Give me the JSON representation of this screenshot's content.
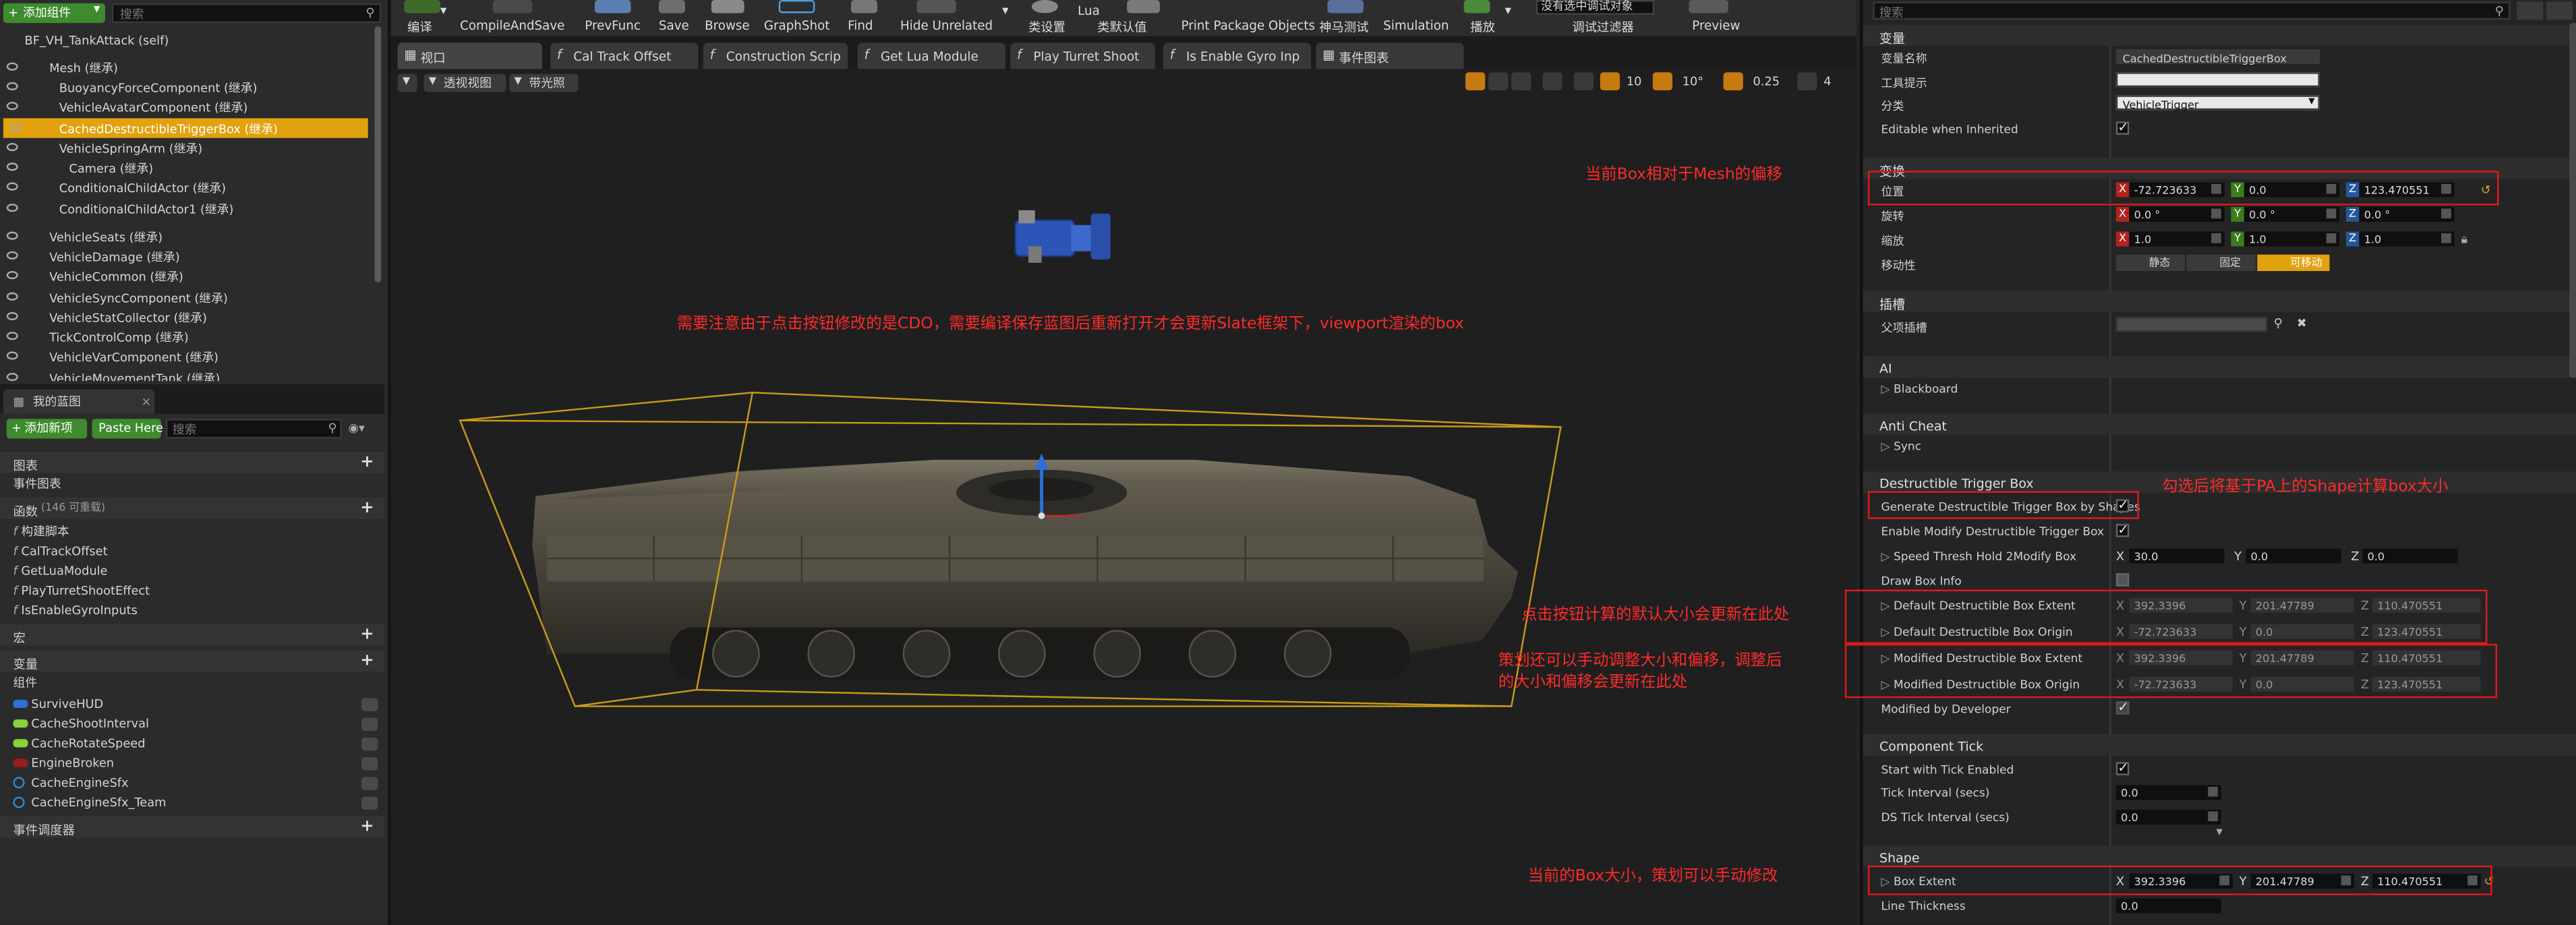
{
  "left_panel": {
    "add_component_label": "添加组件",
    "search_placeholder": "搜索",
    "components": [
      {
        "label": "BF_VH_TankAttack (self)"
      },
      {
        "label": "Mesh (继承)"
      },
      {
        "label": "BuoyancyForceComponent (继承)"
      },
      {
        "label": "VehicleAvatarComponent (继承)"
      },
      {
        "label": "CachedDestructibleTriggerBox (继承)"
      },
      {
        "label": "VehicleSpringArm (继承)"
      },
      {
        "label": "Camera (继承)"
      },
      {
        "label": "ConditionalChildActor (继承)"
      },
      {
        "label": "ConditionalChildActor1 (继承)"
      },
      {
        "label": "VehicleSeats (继承)"
      },
      {
        "label": "VehicleDamage (继承)"
      },
      {
        "label": "VehicleCommon (继承)"
      },
      {
        "label": "VehicleSyncComponent (继承)"
      },
      {
        "label": "VehicleStatCollector (继承)"
      },
      {
        "label": "TickControlComp (继承)"
      },
      {
        "label": "VehicleVarComponent (继承)"
      },
      {
        "label": "VehicleMovementTank (继承)"
      }
    ],
    "my_blueprint_tab": "我的蓝图",
    "add_new_label": "添加新项",
    "paste_here_label": "Paste Here",
    "bp_search_placeholder": "搜索",
    "graphs_label": "图表",
    "event_graph_label": "事件图表",
    "functions_label": "函数",
    "functions_count": "(146 可重载)",
    "functions": [
      "构建脚本",
      "CalTrackOffset",
      "GetLuaModule",
      "PlayTurretShootEffect",
      "IsEnableGyroInputs"
    ],
    "macros_label": "宏",
    "variables_label": "变量",
    "components_group_label": "组件",
    "variables": [
      {
        "label": "SurviveHUD",
        "color": "#2f6fd6"
      },
      {
        "label": "CacheShootInterval",
        "color": "#8bd13a"
      },
      {
        "label": "CacheRotateSpeed",
        "color": "#8bd13a"
      },
      {
        "label": "EngineBroken",
        "color": "#9c1b1b"
      },
      {
        "label": "CacheEngineSfx",
        "color": "#2a8ad6"
      },
      {
        "label": "CacheEngineSfx_Team",
        "color": "#2a8ad6"
      }
    ],
    "event_dispatchers_label": "事件调度器"
  },
  "toolbar": {
    "buttons": [
      "编译",
      "CompileAndSave",
      "PrevFunc",
      "Save",
      "Browse",
      "GraphShot",
      "Find",
      "Hide Unrelated",
      "类设置",
      "类默认值",
      "Print Package Objects",
      "神马测试",
      "Simulation",
      "播放",
      "调试过滤器",
      "Preview"
    ],
    "lua_label": "Lua",
    "debug_dropdown": "没有选中调试对象"
  },
  "tabs": [
    "视口",
    "Cal Track Offset",
    "Construction Scrip",
    "Get Lua Module",
    "Play Turret Shoot",
    "Is Enable Gyro Inp",
    "事件图表"
  ],
  "viewport": {
    "perspective_label": "透视视图",
    "lit_label": "带光照",
    "snap_grid": "10",
    "snap_rot": "10°",
    "snap_scale": "0.25",
    "camera_speed": "4"
  },
  "annotations": {
    "cdo_note": "需要注意由于点击按钮修改的是CDO，需要编译保存蓝图后重新打开才会更新Slate框架下，viewport渲染的box",
    "location_note": "当前Box相对于Mesh的偏移",
    "shapes_note": "勾选后将基于PA上的Shape计算box大小",
    "default_note": "点击按钮计算的默认大小会更新在此处",
    "modified_note_line1": "策划还可以手动调整大小和偏移，调整后",
    "modified_note_line2": "的大小和偏移会更新在此处",
    "extent_note": "当前的Box大小，策划可以手动修改"
  },
  "details": {
    "search_placeholder": "搜索",
    "variables_cat": "变量",
    "variable_name_label": "变量名称",
    "variable_name_value": "CachedDestructibleTriggerBox",
    "tooltip_label": "工具提示",
    "category_label": "分类",
    "category_value": "VehicleTrigger",
    "editable_inherited_label": "Editable when Inherited",
    "transform_cat": "变换",
    "location_label": "位置",
    "location": {
      "x": "-72.723633",
      "y": "0.0",
      "z": "123.470551"
    },
    "rotation_label": "旋转",
    "rotation": {
      "x": "0.0 °",
      "y": "0.0 °",
      "z": "0.0 °"
    },
    "scale_label": "缩放",
    "scale": {
      "x": "1.0",
      "y": "1.0",
      "z": "1.0"
    },
    "mobility_label": "移动性",
    "mobility_options": [
      "静态",
      "固定",
      "可移动"
    ],
    "sockets_cat": "插槽",
    "parent_socket_label": "父项插槽",
    "ai_cat": "AI",
    "blackboard_label": "Blackboard",
    "anticheat_cat": "Anti Cheat",
    "sync_label": "Sync",
    "dtb_cat": "Destructible Trigger Box",
    "gen_by_shapes_label": "Generate Destructible Trigger Box by Shapes",
    "enable_modify_label": "Enable Modify Destructible Trigger Box by Sp",
    "speed_thresh_label": "Speed Thresh Hold 2Modify Box",
    "speed_thresh": {
      "x": "30.0",
      "y": "0.0",
      "z": "0.0"
    },
    "draw_box_info_label": "Draw Box Info",
    "default_extent_label": "Default Destructible Box Extent",
    "default_extent": {
      "x": "392.3396",
      "y": "201.47789",
      "z": "110.470551"
    },
    "default_origin_label": "Default Destructible Box Origin",
    "default_origin": {
      "x": "-72.723633",
      "y": "0.0",
      "z": "123.470551"
    },
    "modified_extent_label": "Modified Destructible Box Extent",
    "modified_extent": {
      "x": "392.3396",
      "y": "201.47789",
      "z": "110.470551"
    },
    "modified_origin_label": "Modified Destructible Box Origin",
    "modified_origin": {
      "x": "-72.723633",
      "y": "0.0",
      "z": "123.470551"
    },
    "modified_by_dev_label": "Modified by Developer",
    "component_tick_cat": "Component Tick",
    "start_tick_label": "Start with Tick Enabled",
    "tick_interval_label": "Tick Interval (secs)",
    "tick_interval_value": "0.0",
    "ds_tick_interval_label": "DS Tick Interval (secs)",
    "ds_tick_interval_value": "0.0",
    "shape_cat": "Shape",
    "box_extent_label": "Box Extent",
    "box_extent": {
      "x": "392.3396",
      "y": "201.47789",
      "z": "110.470551"
    },
    "line_thickness_label": "Line Thickness",
    "line_thickness_value": "0.0"
  }
}
